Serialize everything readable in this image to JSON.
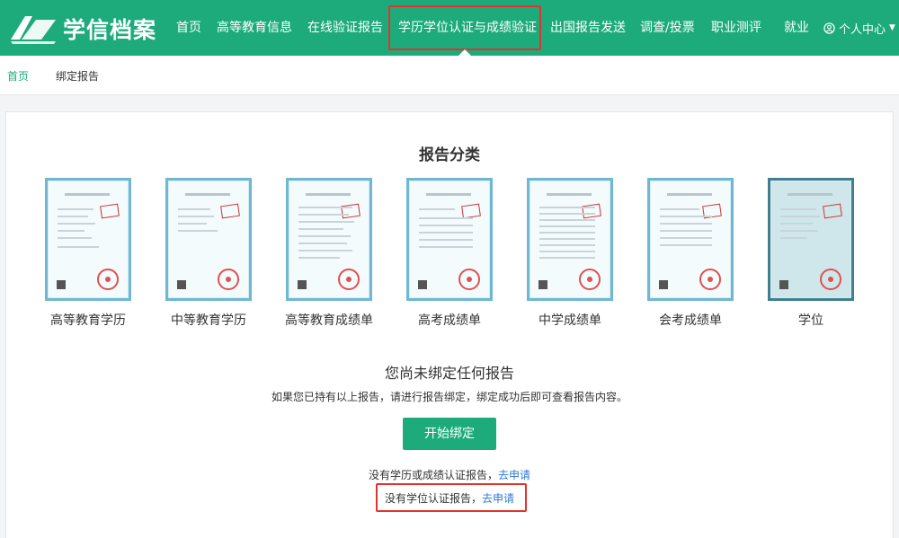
{
  "app": {
    "logo_text": "学信档案",
    "accent_color": "#1dab7b",
    "highlight_color": "#e0342c"
  },
  "nav": {
    "items": [
      {
        "label": "首页"
      },
      {
        "label": "高等教育信息"
      },
      {
        "label": "在线验证报告"
      },
      {
        "label": "学历学位认证与成绩验证",
        "active": true
      },
      {
        "label": "出国报告发送"
      },
      {
        "label": "调查/投票"
      },
      {
        "label": "职业测评"
      },
      {
        "label": "就业"
      }
    ],
    "user_menu": {
      "label": "个人中心",
      "icon": "user-circle-icon"
    }
  },
  "breadcrumb": {
    "home": "首页",
    "current": "绑定报告"
  },
  "main": {
    "section_title": "报告分类",
    "report_types": [
      {
        "label": "高等教育学历"
      },
      {
        "label": "中等教育学历"
      },
      {
        "label": "高等教育成绩单"
      },
      {
        "label": "高考成绩单"
      },
      {
        "label": "中学成绩单"
      },
      {
        "label": "会考成绩单"
      },
      {
        "label": "学位"
      }
    ],
    "empty_title": "您尚未绑定任何报告",
    "empty_desc": "如果您已持有以上报告，请进行报告绑定，绑定成功后即可查看报告内容。",
    "bind_button": "开始绑定",
    "apply1_text": "没有学历或成绩认证报告，",
    "apply1_link": "去申请",
    "apply2_text": "没有学位认证报告，",
    "apply2_link": "去申请"
  }
}
